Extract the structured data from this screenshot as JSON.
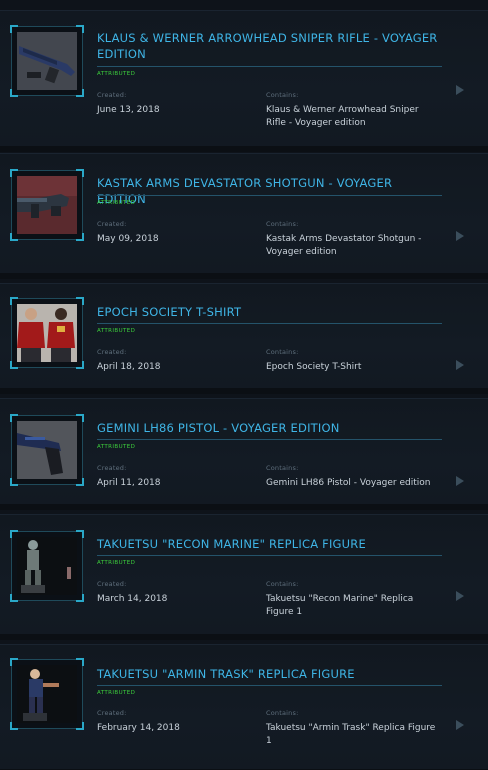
{
  "labels": {
    "created": "Created:",
    "contains": "Contains:"
  },
  "items": [
    {
      "title": "Klaus & Werner Arrowhead Sniper Rifle - Voyager Edition",
      "badge": "ATTRIBUTED",
      "created": "June 13, 2018",
      "contains": "Klaus & Werner Arrowhead Sniper Rifle - Voyager edition",
      "thumbnail": "sniper-rifle-icon"
    },
    {
      "title": "Kastak Arms Devastator Shotgun - Voyager Edition",
      "badge": "ATTRIBUTED",
      "created": "May 09, 2018",
      "contains": "Kastak Arms Devastator Shotgun - Voyager edition",
      "thumbnail": "shotgun-icon"
    },
    {
      "title": "Epoch Society T-Shirt",
      "badge": "ATTRIBUTED",
      "created": "April 18, 2018",
      "contains": "Epoch Society T-Shirt",
      "thumbnail": "tshirt-icon"
    },
    {
      "title": "Gemini LH86 Pistol - Voyager Edition",
      "badge": "ATTRIBUTED",
      "created": "April 11, 2018",
      "contains": "Gemini LH86 Pistol - Voyager edition",
      "thumbnail": "pistol-icon"
    },
    {
      "title": "Takuetsu \"Recon Marine\" Replica Figure",
      "badge": "ATTRIBUTED",
      "created": "March 14, 2018",
      "contains": "Takuetsu \"Recon Marine\" Replica Figure 1",
      "thumbnail": "figure-marine-icon"
    },
    {
      "title": "Takuetsu \"Armin Trask\" Replica Figure",
      "badge": "ATTRIBUTED",
      "created": "February 14, 2018",
      "contains": "Takuetsu \"Armin Trask\" Replica Figure 1",
      "thumbnail": "figure-trask-icon"
    }
  ]
}
